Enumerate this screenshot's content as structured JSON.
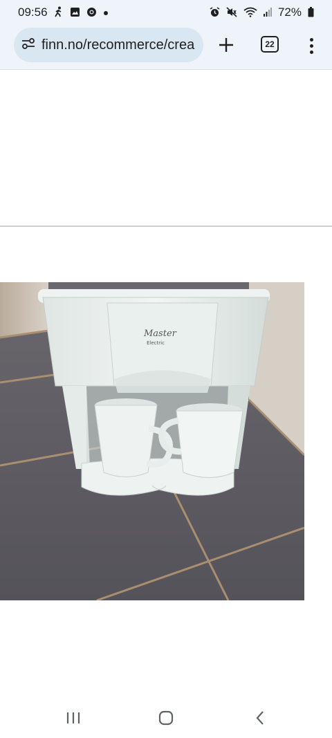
{
  "status_bar": {
    "time": "09:56",
    "battery_percent": "72%",
    "left_icons": [
      "walking-icon",
      "gallery-icon",
      "chrome-icon",
      "dot-icon"
    ],
    "right_icons": [
      "alarm-icon",
      "mute-icon",
      "wifi-icon",
      "signal-icon",
      "battery-icon"
    ]
  },
  "browser": {
    "url": "finn.no/recommerce/crea",
    "tab_count": "22"
  },
  "photo": {
    "brand_text": "Master",
    "brand_subtext": "Electric"
  },
  "colors": {
    "chrome_bg": "#eef4fa",
    "url_pill": "#d9e7f2",
    "tile": "#5f5d63",
    "grout": "#a98f70",
    "appliance": "#e8eeeb"
  },
  "nav_bar": {
    "buttons": [
      "recent-apps-icon",
      "home-icon",
      "back-icon"
    ]
  }
}
